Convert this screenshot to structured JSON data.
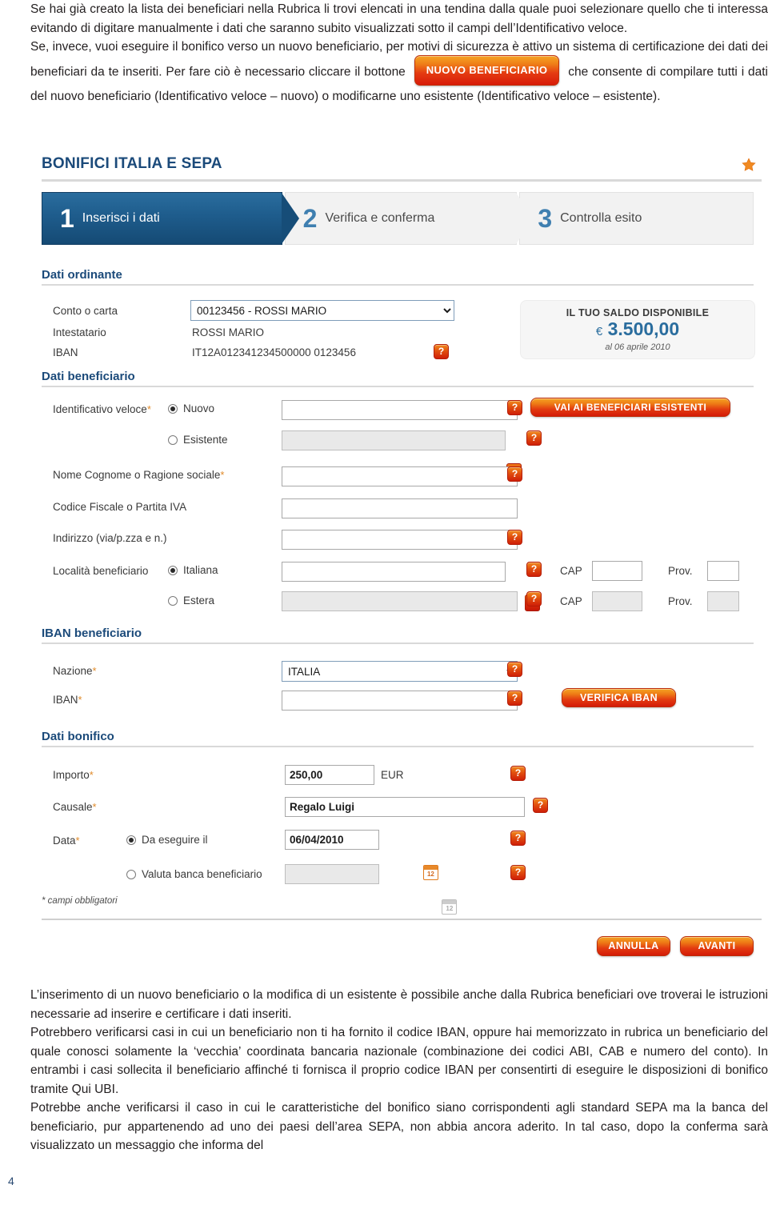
{
  "top_prose": {
    "p1_before": "Se hai già creato la lista dei beneficiari nella Rubrica li trovi elencati in una tendina dalla quale puoi selezionare quello che ti interessa evitando di digitare manualmente i dati che saranno subito visualizzati sotto il campi dell’Identificativo veloce.",
    "p2_part1": "Se, invece, vuoi eseguire il bonifico verso un nuovo beneficiario, per motivi di sicurezza è attivo un sistema di certificazione dei dati dei beneficiari da te inseriti. Per fare ciò è necessario cliccare il bottone",
    "button_label": "NUOVO BENEFICIARIO",
    "p2_part2": "che consente di compilare tutti i dati del nuovo beneficiario (Identificativo veloce – nuovo) o modificarne uno esistente (Identificativo veloce – esistente)."
  },
  "app": {
    "title": "BONIFICI ITALIA E SEPA",
    "star_icon": "star-icon",
    "steps": [
      {
        "num": "1",
        "label": "Inserisci i dati",
        "active": true
      },
      {
        "num": "2",
        "label": "Verifica e conferma",
        "active": false
      },
      {
        "num": "3",
        "label": "Controlla esito",
        "active": false
      }
    ],
    "sections": {
      "ordinante": {
        "title": "Dati ordinante",
        "conto_label": "Conto o carta",
        "conto_value": "00123456 - ROSSI MARIO",
        "intestatario_label": "Intestatario",
        "intestatario_value": "ROSSI MARIO",
        "iban_label": "IBAN",
        "iban_value": "IT12A012341234500000 0123456",
        "help_icon": "?"
      },
      "balance": {
        "title": "IL TUO SALDO DISPONIBILE",
        "currency": "€",
        "amount": "3.500,00",
        "as_of": "al 06 aprile 2010"
      },
      "beneficiario": {
        "title": "Dati beneficiario",
        "identificativo_label": "Identificativo veloce",
        "radio_nuovo": "Nuovo",
        "radio_esistente": "Esistente",
        "nuovo_value": "",
        "esistente_value": "",
        "go_existing_button": "VAI AI BENEFICIARI ESISTENTI",
        "nome_label": "Nome Cognome o Ragione sociale",
        "nome_value": "",
        "codfisc_label": "Codice Fiscale o Partita IVA",
        "codfisc_value": "",
        "indirizzo_label": "Indirizzo (via/p.zza e n.)",
        "indirizzo_value": "",
        "localita_label": "Località beneficiario",
        "radio_italiana": "Italiana",
        "radio_estera": "Estera",
        "localita_ita_value": "",
        "localita_est_value": "",
        "cap_label": "CAP",
        "cap_ita_value": "",
        "cap_est_value": "",
        "prov_label": "Prov.",
        "prov_ita_value": "",
        "prov_est_value": ""
      },
      "iban_beneficiario": {
        "title": "IBAN beneficiario",
        "nazione_label": "Nazione",
        "nazione_value": "ITALIA",
        "iban_label": "IBAN",
        "iban_value": "",
        "verify_button": "VERIFICA IBAN"
      },
      "bonifico": {
        "title": "Dati bonifico",
        "importo_label": "Importo",
        "importo_value": "250,00",
        "currency_label": "EUR",
        "causale_label": "Causale",
        "causale_value": "Regalo Luigi",
        "data_label": "Data",
        "radio_da_eseguire": "Da eseguire il",
        "data_value": "06/04/2010",
        "radio_valuta": "Valuta banca beneficiario",
        "valuta_value": "",
        "calendar_icon_day": "12"
      }
    },
    "mandatory_note": "* campi obbligatori",
    "footer_buttons": {
      "cancel": "ANNULLA",
      "next": "AVANTI"
    },
    "colors": {
      "brand_blue": "#1b4a7a",
      "accent_orange": "#e2500f",
      "step_active": "#1e5c8c",
      "balance_blue": "#2a6d9e"
    }
  },
  "bottom_prose": {
    "p1": "L’inserimento di un nuovo beneficiario o la modifica di un esistente è possibile anche dalla Rubrica beneficiari ove troverai le istruzioni necessarie ad inserire e certificare i dati inseriti.",
    "p2": "Potrebbero verificarsi casi in cui un beneficiario non ti ha fornito il codice IBAN, oppure hai memorizzato in rubrica un beneficiario del quale conosci solamente la ‘vecchia’ coordinata bancaria nazionale (combinazione dei codici ABI, CAB e numero del conto). In entrambi i casi sollecita il beneficiario affinché ti fornisca il proprio codice IBAN per consentirti di eseguire le disposizioni di bonifico tramite Qui UBI.",
    "p3": "Potrebbe anche verificarsi il caso in cui le caratteristiche del bonifico siano corrispondenti agli standard SEPA ma la banca del beneficiario, pur appartenendo ad uno dei paesi dell’area SEPA, non abbia ancora aderito. In tal caso, dopo la conferma sarà visualizzato un messaggio che informa del"
  },
  "page_number": "4"
}
